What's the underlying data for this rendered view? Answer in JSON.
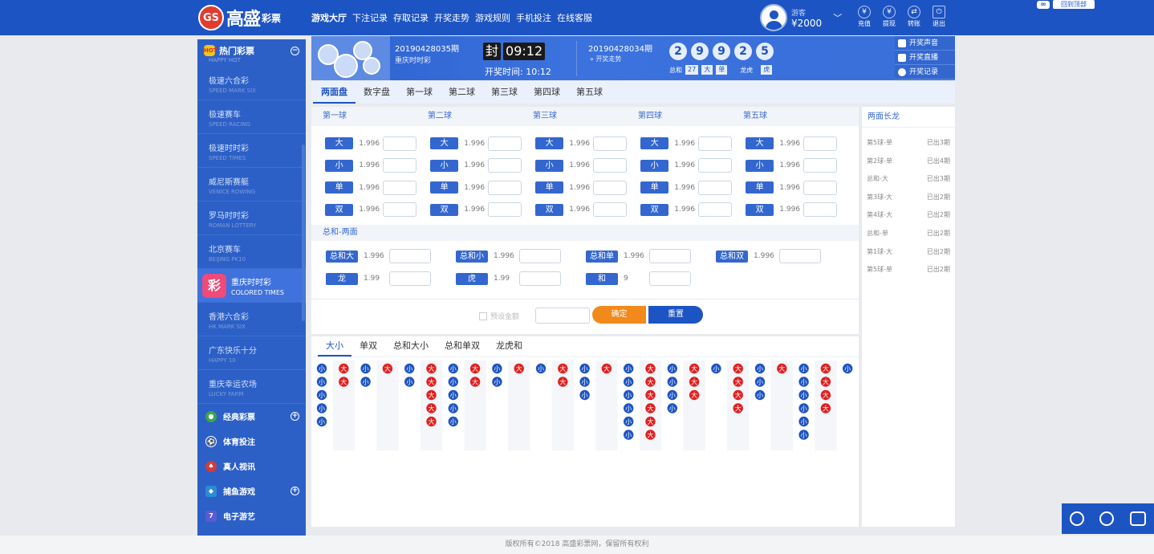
{
  "header": {
    "logo_mark": "GS",
    "logo_text": "高盛",
    "logo_sub": "彩票",
    "nav": [
      "游戏大厅",
      "下注记录",
      "存取记录",
      "开奖走势",
      "游戏规则",
      "手机投注",
      "在线客服"
    ],
    "user": {
      "name": "游客",
      "balance": "¥2000"
    },
    "icons": [
      {
        "label": "充值",
        "icon": "deposit-icon"
      },
      {
        "label": "提现",
        "icon": "withdraw-icon"
      },
      {
        "label": "转账",
        "icon": "transfer-icon"
      },
      {
        "label": "退出",
        "icon": "logout-icon"
      }
    ],
    "corner_button": "回到顶部"
  },
  "sidebar": {
    "hot_title": "热门彩票",
    "hot_sub": "HAPPY HOT",
    "items": [
      {
        "title": "极速六合彩",
        "sub": "SPEED MARK SIX"
      },
      {
        "title": "极速赛车",
        "sub": "SPEED RACING"
      },
      {
        "title": "极速时时彩",
        "sub": "SPEED TIMES"
      },
      {
        "title": "威尼斯赛艇",
        "sub": "VENICE ROWING"
      },
      {
        "title": "罗马时时彩",
        "sub": "ROMAN LOTTERY"
      },
      {
        "title": "北京赛车",
        "sub": "BEIJING PK10"
      },
      {
        "title": "重庆时时彩",
        "sub": "COLORED TIMES",
        "active": true
      },
      {
        "title": "香港六合彩",
        "sub": "HK MARK SIX"
      },
      {
        "title": "广东快乐十分",
        "sub": "HAPPY 10"
      },
      {
        "title": "重庆幸运农场",
        "sub": "LUCKY FARM"
      }
    ],
    "active_badge": "彩",
    "categories": [
      {
        "label": "经典彩票",
        "color": "#3aa64a",
        "toggle": true
      },
      {
        "label": "体育投注",
        "color": "#2c60c7",
        "toggle": false
      },
      {
        "label": "真人视讯",
        "color": "#d33b3b",
        "toggle": false
      },
      {
        "label": "捕鱼游戏",
        "color": "#2c8ad6",
        "toggle": true
      },
      {
        "label": "电子游艺",
        "color": "#5a5ad8",
        "toggle": false
      }
    ]
  },
  "banner": {
    "current_issue": "20190428035期",
    "lottery_name": "重庆时时彩",
    "seal": "封",
    "countdown": "09:12",
    "open_time_label": "开奖时间:",
    "open_time": "10:12",
    "last_issue": "20190428034期",
    "trend_link": "» 开奖走势",
    "win_numbers": [
      "2",
      "9",
      "9",
      "2",
      "5"
    ],
    "sum_label": "总和",
    "sum_value": "27",
    "sum_size": "大",
    "sum_parity": "单",
    "dragon_tiger_label": "龙虎",
    "dragon_tiger_value": "虎",
    "buttons": [
      "开奖声音",
      "开奖直播",
      "开奖记录"
    ]
  },
  "tabs": [
    "两面盘",
    "数字盘",
    "第一球",
    "第二球",
    "第三球",
    "第四球",
    "第五球"
  ],
  "odds": {
    "balls": [
      "第一球",
      "第二球",
      "第三球",
      "第四球",
      "第五球"
    ],
    "options": [
      "大",
      "小",
      "单",
      "双"
    ],
    "odd_value": "1.996"
  },
  "sum_section": {
    "title": "总和-两面",
    "row1": [
      {
        "label": "总和大",
        "odd": "1.996"
      },
      {
        "label": "总和小",
        "odd": "1.996"
      },
      {
        "label": "总和单",
        "odd": "1.996"
      },
      {
        "label": "总和双",
        "odd": "1.996"
      }
    ],
    "row2": [
      {
        "label": "龙",
        "odd": "1.99"
      },
      {
        "label": "虎",
        "odd": "1.99"
      },
      {
        "label": "和",
        "odd": "9"
      }
    ]
  },
  "submit": {
    "quick_label": "预设金额",
    "confirm": "确定",
    "reset": "重置"
  },
  "long_dragon": {
    "title": "两面长龙",
    "rows": [
      {
        "name": "第5球-单",
        "count": "已出3期"
      },
      {
        "name": "第2球-单",
        "count": "已出4期"
      },
      {
        "name": "总和-大",
        "count": "已出3期"
      },
      {
        "name": "第3球-大",
        "count": "已出2期"
      },
      {
        "name": "第4球-大",
        "count": "已出2期"
      },
      {
        "name": "总和-单",
        "count": "已出2期"
      },
      {
        "name": "第1球-大",
        "count": "已出2期"
      },
      {
        "name": "第5球-单",
        "count": "已出2期"
      }
    ]
  },
  "road": {
    "tabs": [
      "大小",
      "单双",
      "总和大小",
      "总和单双",
      "龙虎和"
    ],
    "big_label": "大",
    "small_label": "小",
    "big_color": "#e02020",
    "small_color": "#1d54c3",
    "columns": [
      [
        "小",
        "小",
        "小",
        "小",
        "小"
      ],
      [
        "大",
        "大"
      ],
      [
        "小",
        "小"
      ],
      [
        "大"
      ],
      [
        "小",
        "小"
      ],
      [
        "大",
        "大",
        "大",
        "大",
        "大"
      ],
      [
        "小",
        "小",
        "小",
        "小",
        "小"
      ],
      [
        "大",
        "大"
      ],
      [
        "小",
        "小"
      ],
      [
        "大"
      ],
      [
        "小"
      ],
      [
        "大",
        "大"
      ],
      [
        "小",
        "小",
        "小"
      ],
      [
        "大"
      ],
      [
        "小",
        "小",
        "小",
        "小",
        "小",
        "小"
      ],
      [
        "大",
        "大",
        "大",
        "大",
        "大",
        "大"
      ],
      [
        "小",
        "小",
        "小",
        "小"
      ],
      [
        "大",
        "大",
        "大"
      ],
      [
        "小"
      ],
      [
        "大",
        "大",
        "大",
        "大"
      ],
      [
        "小",
        "小",
        "小"
      ],
      [
        "大"
      ],
      [
        "小",
        "小",
        "小",
        "小",
        "小",
        "小"
      ],
      [
        "大",
        "大",
        "大",
        "大"
      ],
      [
        "小"
      ]
    ]
  },
  "footer": "版权所有©2018 高盛彩票网，保留所有权利",
  "float_icons": [
    "chat-icon",
    "service-icon",
    "mail-icon"
  ]
}
